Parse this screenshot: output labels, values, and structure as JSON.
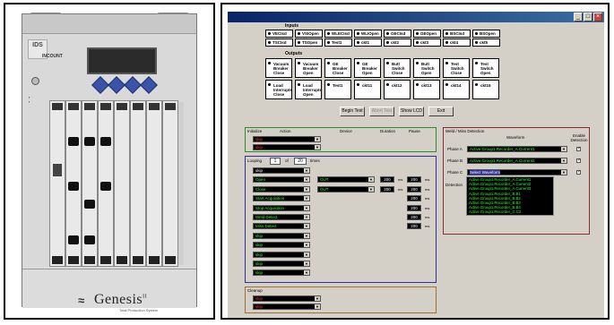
{
  "device": {
    "logo": "IDS",
    "brand_sub": "INCOUNT",
    "brand_name": "Genesis",
    "brand_suffix": "II",
    "brand_tagline": "Total Production System"
  },
  "app": {
    "title": "",
    "inputs_label": "Inputs",
    "inputs_row1": [
      "VECIsd",
      "VSIOpen",
      "WLECIsd",
      "WLIOpen",
      "GECIsd",
      "GEOpen",
      "BSCIsd",
      "BSOpen"
    ],
    "inputs_row2": [
      "TSCIsd",
      "TSOpen",
      "Test1",
      "ckt1",
      "ckt2",
      "ckt3",
      "ckt4",
      "ckt5"
    ],
    "outputs_label": "Outputs",
    "outputs_row1": [
      "Vacuum Breaker Close",
      "Vacuum Breaker Open",
      "GE Breaker Close",
      "GE Breaker Open",
      "Butt Switch Close",
      "Butt Switch Open",
      "Test Switch Close",
      "Test Switch Open"
    ],
    "outputs_row2": [
      "Load Interrupter Close",
      "Load Interrupter Open",
      "Test1",
      "ckt11",
      "ckt12",
      "ckt13",
      "ckt14",
      "ckt15"
    ],
    "buttons": {
      "begin": "Begin Test",
      "abort": "Abort Test",
      "show_lcd": "Show LCD",
      "exit": "Exit"
    },
    "initialize": {
      "label": "Initialize",
      "headers": {
        "action": "Action",
        "device": "Device",
        "duration": "Duration",
        "pause": "Pause"
      },
      "rows": [
        "skip",
        "skip"
      ]
    },
    "looping": {
      "label": "Looping",
      "current": "1",
      "of_label": "of",
      "total": "20",
      "times_label": "times",
      "rows": [
        {
          "action": "skip",
          "device": "",
          "duration": "",
          "pause": ""
        },
        {
          "action": "Open",
          "device": "OUT",
          "duration": "200",
          "pause": "200"
        },
        {
          "action": "Close",
          "device": "OUT",
          "duration": "200",
          "pause": "200"
        },
        {
          "action": "Start Acquisition",
          "device": "",
          "duration": "",
          "pause": "200"
        },
        {
          "action": "Stop Acquisition",
          "device": "",
          "duration": "",
          "pause": "200"
        },
        {
          "action": "Weld Detect",
          "device": "",
          "duration": "",
          "pause": "200"
        },
        {
          "action": "Miss Detect",
          "device": "",
          "duration": "",
          "pause": "200"
        },
        {
          "action": "skip",
          "device": "",
          "duration": "",
          "pause": ""
        },
        {
          "action": "skip",
          "device": "",
          "duration": "",
          "pause": ""
        },
        {
          "action": "skip",
          "device": "",
          "duration": "",
          "pause": ""
        },
        {
          "action": "skip",
          "device": "",
          "duration": "",
          "pause": ""
        },
        {
          "action": "skip",
          "device": "",
          "duration": "",
          "pause": ""
        }
      ],
      "unit": "ms"
    },
    "cleanup": {
      "label": "Cleanup",
      "rows": [
        "skip",
        "skip"
      ]
    },
    "weld": {
      "label": "Weld / Miss Detection",
      "waveform_header": "Waveform",
      "enable_header": "Enable Detection",
      "phases": [
        {
          "label": "Phase A",
          "value": "Active.Group1.Recorder_A.Current1",
          "checked": true
        },
        {
          "label": "Phase B",
          "value": "Active.Group1.Recorder_A.Current2",
          "checked": true
        },
        {
          "label": "Phase C",
          "value": "Select Waveform",
          "checked": true
        }
      ],
      "detection_label": "Detection",
      "dropdown_options": [
        "Active.Group1.Recorder_A.Current1",
        "Active.Group1.Recorder_A.Current2",
        "Active.Group1.Recorder_A.Current3",
        "Active.Group1.Recorder_B.B1",
        "Active.Group1.Recorder_B.B2",
        "Active.Group1.Recorder_B.B3",
        "Active.Group1.Recorder_B.B4",
        "Active.Group1.Recorder_C.C2"
      ]
    }
  }
}
